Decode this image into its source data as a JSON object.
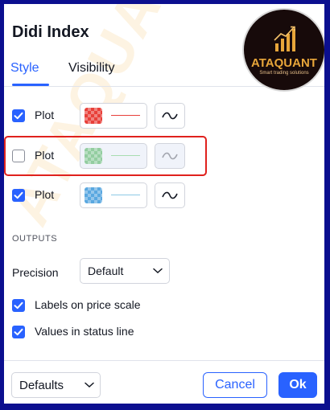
{
  "dialog": {
    "title": "Didi Index"
  },
  "tabs": [
    {
      "label": "Style",
      "active": true
    },
    {
      "label": "Visibility",
      "active": false
    }
  ],
  "plots": [
    {
      "label": "Plot",
      "checked": true,
      "color": "#e8403a",
      "line_color": "#e8403a"
    },
    {
      "label": "Plot",
      "checked": false,
      "color": "#7cc48a",
      "line_color": "#a8dcb0",
      "highlighted": true
    },
    {
      "label": "Plot",
      "checked": true,
      "color": "#5aa8e0",
      "line_color": "#8ecae6"
    }
  ],
  "outputs": {
    "section_label": "OUTPUTS",
    "precision_label": "Precision",
    "precision_value": "Default",
    "labels_on_price_scale": "Labels on price scale",
    "values_in_status_line": "Values in status line"
  },
  "footer": {
    "defaults_label": "Defaults",
    "cancel_label": "Cancel",
    "ok_label": "Ok"
  },
  "logo": {
    "name": "ATAQUANT",
    "tagline": "Smart trading solutions"
  },
  "watermark": "ATAQUANT",
  "colors": {
    "accent": "#2962ff",
    "highlight": "#e0211d"
  }
}
